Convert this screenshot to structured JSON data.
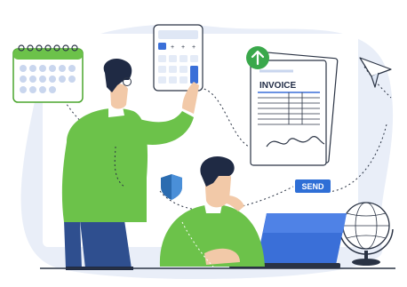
{
  "invoice": {
    "title": "INVOICE"
  },
  "send_button": {
    "label": "SEND"
  },
  "colors": {
    "blob_background": "#e9eef8",
    "card_background": "#ffffff",
    "shirt_green": "#6cc24a",
    "shirt_dark_green": "#4aa52d",
    "jeans_blue": "#2f4f8f",
    "hair_dark": "#1f2a44",
    "skin": "#f2c9a8",
    "laptop_blue": "#3a6fd8",
    "shield_blue": "#2b6cb0",
    "send_blue": "#2f6fd6",
    "arrow_green": "#3aa84b",
    "line_dark": "#2a3344"
  },
  "icons": [
    "calendar-icon",
    "calculator-icon",
    "upload-arrow-icon",
    "paper-plane-icon",
    "shield-icon",
    "globe-icon",
    "laptop-icon"
  ]
}
